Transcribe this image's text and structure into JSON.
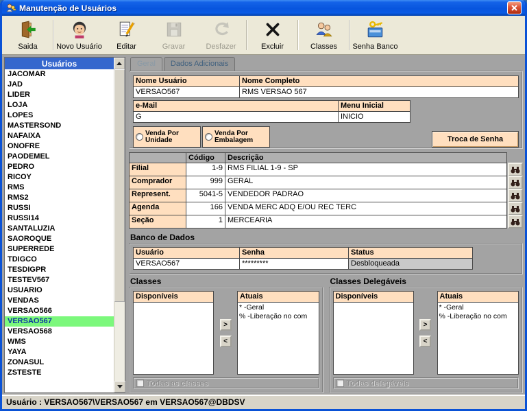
{
  "window": {
    "title": "Manutenção de Usuários"
  },
  "toolbar": {
    "buttons": [
      {
        "label": "Saida",
        "icon": "exit-icon",
        "enabled": true
      },
      {
        "label": "Novo Usuário",
        "icon": "new-user-icon",
        "enabled": true
      },
      {
        "label": "Editar",
        "icon": "edit-icon",
        "enabled": true
      },
      {
        "label": "Gravar",
        "icon": "save-icon",
        "enabled": false
      },
      {
        "label": "Desfazer",
        "icon": "undo-icon",
        "enabled": false
      },
      {
        "label": "Excluir",
        "icon": "delete-icon",
        "enabled": true
      },
      {
        "label": "Classes",
        "icon": "classes-icon",
        "enabled": true
      },
      {
        "label": "Senha Banco",
        "icon": "password-icon",
        "enabled": true
      }
    ]
  },
  "sidebar": {
    "header": "Usuários",
    "selected": "VERSAO567",
    "users": [
      "JACOMAR",
      "JAD",
      "LIDER",
      "LOJA",
      "LOPES",
      "MASTERSOND",
      "NAFAIXA",
      "ONOFRE",
      "PAODEMEL",
      "PEDRO",
      "RICOY",
      "RMS",
      "RMS2",
      "RUSSI",
      "RUSSI14",
      "SANTALUZIA",
      "SAOROQUE",
      "SUPERREDE",
      "TDIGCO",
      "TESDIGPR",
      "TESTEV567",
      "USUARIO",
      "VENDAS",
      "VERSAO566",
      "VERSAO567",
      "VERSAO568",
      "WMS",
      "YAYA",
      "ZONASUL",
      "ZSTESTE"
    ]
  },
  "tabs": [
    {
      "label": "Geral",
      "active": true
    },
    {
      "label": "Dados Adicionais",
      "active": false
    }
  ],
  "form": {
    "nome_usuario": {
      "label": "Nome Usuário",
      "value": "VERSAO567"
    },
    "nome_completo": {
      "label": "Nome Completo",
      "value": "RMS VERSAO 567"
    },
    "email": {
      "label": "e-Mail",
      "value": "G"
    },
    "menu_inicial": {
      "label": "Menu Inicial",
      "value": "INICIO"
    },
    "radio_unidade": "Venda Por Unidade",
    "radio_embalagem": "Venda Por Embalagem",
    "troca_senha": "Troca de Senha"
  },
  "lookup": {
    "header_codigo": "Código",
    "header_descricao": "Descrição",
    "rows": [
      {
        "label": "Filial",
        "codigo": "1-9",
        "descricao": "RMS FILIAL 1-9 - SP"
      },
      {
        "label": "Comprador",
        "codigo": "999",
        "descricao": "GERAL"
      },
      {
        "label": "Represent.",
        "codigo": "5041-5",
        "descricao": "VENDEDOR PADRAO"
      },
      {
        "label": "Agenda",
        "codigo": "166",
        "descricao": "VENDA MERC ADQ E/OU REC TERC"
      },
      {
        "label": "Seção",
        "codigo": "1",
        "descricao": "MERCEARIA"
      }
    ]
  },
  "banco": {
    "title": "Banco de Dados",
    "usuario": {
      "label": "Usuário",
      "value": "VERSAO567"
    },
    "senha": {
      "label": "Senha",
      "value": "*********"
    },
    "status": {
      "label": "Status",
      "value": "Desbloqueada"
    }
  },
  "classes": {
    "title": "Classes",
    "disponiveis": "Disponíveis",
    "atuais": "Atuais",
    "items": [
      "* -Geral",
      "% -Liberação no com"
    ],
    "checkbox": "Todas as classes"
  },
  "delegaveis": {
    "title": "Classes Delegáveis",
    "disponiveis": "Disponíveis",
    "atuais": "Atuais",
    "items": [
      "* -Geral",
      "% -Liberação no com"
    ],
    "checkbox": "Todas delegáveis"
  },
  "icons": {
    "move_right": ">",
    "move_left": "<"
  },
  "statusbar": {
    "text": "Usuário : VERSAO567\\VERSAO567 em VERSAO567@DBDSV"
  },
  "colors": {
    "accent_blue": "#0A52D6",
    "peach": "#FFDFBF",
    "selected_green": "#7CF87C",
    "toolbar_bg": "#ECE9D8",
    "form_bg": "#A3A3A3"
  }
}
